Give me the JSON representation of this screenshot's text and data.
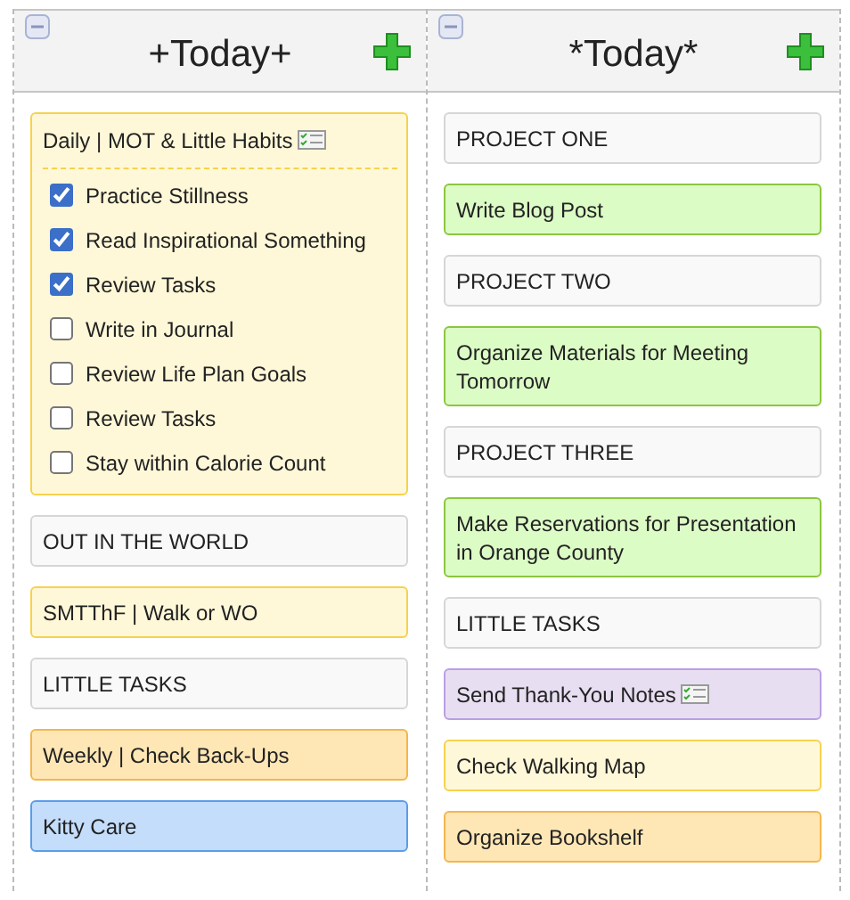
{
  "columns": [
    {
      "title": "+Today+",
      "cards": [
        {
          "title": "Daily | MOT & Little Habits",
          "color": "#fff8d8",
          "checklist_icon": true,
          "checklist": [
            {
              "label": "Practice Stillness",
              "checked": true
            },
            {
              "label": "Read Inspirational Something",
              "checked": true
            },
            {
              "label": "Review Tasks",
              "checked": true
            },
            {
              "label": "Write in Journal",
              "checked": false
            },
            {
              "label": "Review Life Plan Goals",
              "checked": false
            },
            {
              "label": "Review Tasks",
              "checked": false
            },
            {
              "label": "Stay within Calorie Count",
              "checked": false
            }
          ]
        },
        {
          "title": "OUT IN THE WORLD",
          "color": "#f9f9f9"
        },
        {
          "title": "SMTThF | Walk or WO",
          "color": "#fff8d8"
        },
        {
          "title": "LITTLE TASKS",
          "color": "#f9f9f9"
        },
        {
          "title": "Weekly | Check Back-Ups",
          "color": "#ffe7b5"
        },
        {
          "title": "Kitty Care",
          "color": "#c4ddfb"
        }
      ]
    },
    {
      "title": "*Today*",
      "cards": [
        {
          "title": "PROJECT ONE",
          "color": "#f9f9f9"
        },
        {
          "title": "Write Blog Post",
          "color": "#dcfcc6"
        },
        {
          "title": "PROJECT TWO",
          "color": "#f9f9f9"
        },
        {
          "title": "Organize Materials for Meeting Tomorrow",
          "color": "#dcfcc6"
        },
        {
          "title": "PROJECT THREE",
          "color": "#f9f9f9"
        },
        {
          "title": "Make Reservations for Presentation in Orange County",
          "color": "#dcfcc6"
        },
        {
          "title": "LITTLE TASKS",
          "color": "#f9f9f9"
        },
        {
          "title": "Send Thank-You Notes",
          "color": "#e8def2",
          "checklist_icon": true
        },
        {
          "title": "Check Walking Map",
          "color": "#fff8d8"
        },
        {
          "title": "Organize Bookshelf",
          "color": "#ffe7b5"
        }
      ]
    }
  ]
}
